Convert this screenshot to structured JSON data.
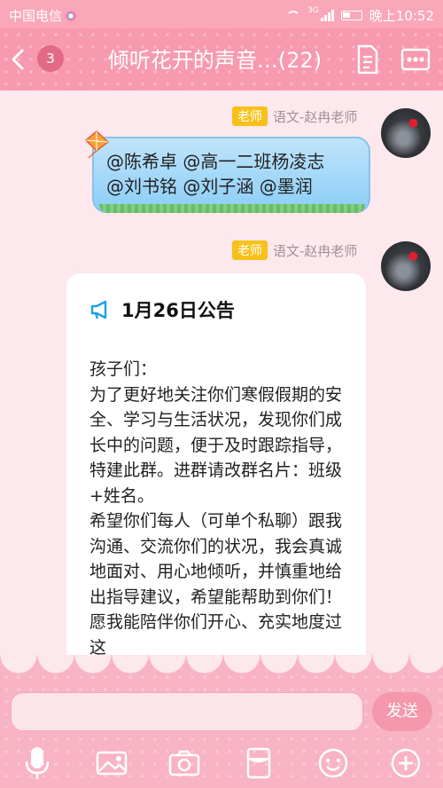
{
  "status_bar": {
    "carrier": "中国电信",
    "network": "3G",
    "time": "晚上10:52"
  },
  "header": {
    "unread_count": "3",
    "title": "倾听花开的声音…(22)"
  },
  "messages": [
    {
      "role_badge": "老师",
      "sender": "语文-赵冉老师",
      "text_line1": "@陈希卓 @高一二班杨凌志",
      "text_line2": "@刘书铭 @刘子涵 @墨润"
    },
    {
      "role_badge": "老师",
      "sender": "语文-赵冉老师",
      "notice_title": "1月26日公告",
      "notice_body": "孩子们：\n 为了更好地关注你们寒假假期的安全、学习与生活状况，发现你们成长中的问题，便于及时跟踪指导，特建此群。进群请改群名片：班级+姓名。\n 希望你们每人（可单个私聊）跟我沟通、交流你们的状况，我会真诚地面对、用心地倾听，并慎重地给出指导建议，希望能帮助到你们！愿我能陪伴你们开心、充实地度过这"
    }
  ],
  "input": {
    "send_label": "发送"
  },
  "toolbar": {
    "icons": [
      "microphone-icon",
      "image-icon",
      "camera-icon",
      "red-packet-icon",
      "emoji-icon",
      "plus-icon"
    ]
  },
  "colors": {
    "header_pink": "#f79ab0",
    "badge_yellow": "#f7c11a",
    "bubble_blue": "#8ccdf6",
    "background": "#fde8ee"
  }
}
